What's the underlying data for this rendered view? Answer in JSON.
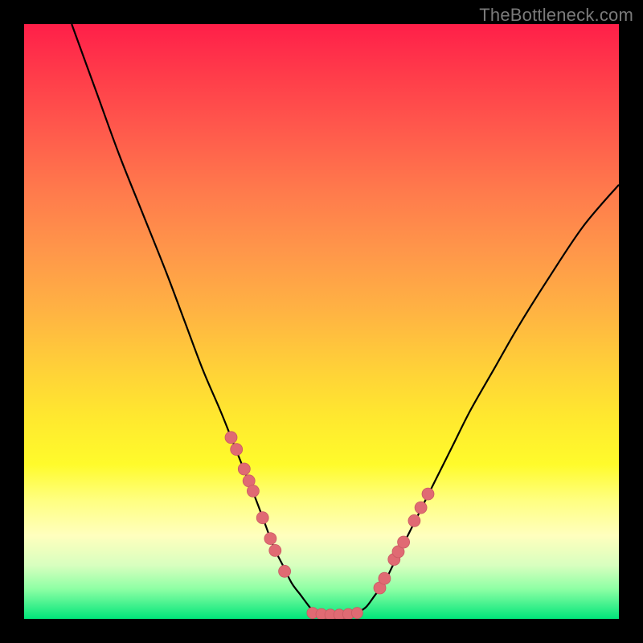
{
  "watermark": "TheBottleneck.com",
  "colors": {
    "curve": "#000000",
    "marker_fill": "#e06a73",
    "marker_stroke": "#c95a63"
  },
  "chart_data": {
    "type": "line",
    "title": "",
    "xlabel": "",
    "ylabel": "",
    "xlim": [
      0,
      100
    ],
    "ylim": [
      0,
      100
    ],
    "grid": false,
    "legend": false,
    "series": [
      {
        "name": "left-curve",
        "x": [
          8,
          12,
          16,
          20,
          24,
          27,
          30,
          33,
          35,
          37,
          39,
          40.5,
          42,
          43.5,
          45,
          46.5,
          48,
          49
        ],
        "y": [
          100,
          89,
          78,
          68,
          58,
          50,
          42,
          35,
          30,
          25,
          20,
          16,
          12,
          9,
          6,
          4,
          2,
          1
        ]
      },
      {
        "name": "right-curve",
        "x": [
          56,
          57.5,
          59,
          60.5,
          62,
          63.5,
          65,
          67,
          69,
          72,
          75,
          79,
          83,
          88,
          94,
          100
        ],
        "y": [
          1,
          2,
          4,
          6,
          9,
          12,
          15,
          19,
          23,
          29,
          35,
          42,
          49,
          57,
          66,
          73
        ]
      },
      {
        "name": "flat-bottom",
        "x": [
          49,
          50,
          51,
          52,
          53,
          54,
          55,
          56
        ],
        "y": [
          1,
          0.6,
          0.4,
          0.3,
          0.3,
          0.4,
          0.6,
          1
        ]
      }
    ],
    "markers_left": {
      "x": [
        34.8,
        35.7,
        37.0,
        37.8,
        38.5,
        40.1,
        41.4,
        42.2,
        43.8
      ],
      "y": [
        30.5,
        28.5,
        25.2,
        23.2,
        21.5,
        17.0,
        13.5,
        11.5,
        8.0
      ]
    },
    "markers_right": {
      "x": [
        59.8,
        60.6,
        62.2,
        62.9,
        63.8,
        65.6,
        66.7,
        67.9
      ],
      "y": [
        5.2,
        6.8,
        10.0,
        11.3,
        12.9,
        16.5,
        18.7,
        21.0
      ]
    },
    "markers_bottom": {
      "x": [
        48.5,
        50.0,
        51.5,
        53.0,
        54.5,
        56.0
      ],
      "y": [
        1.0,
        0.8,
        0.7,
        0.7,
        0.8,
        1.0
      ]
    }
  }
}
